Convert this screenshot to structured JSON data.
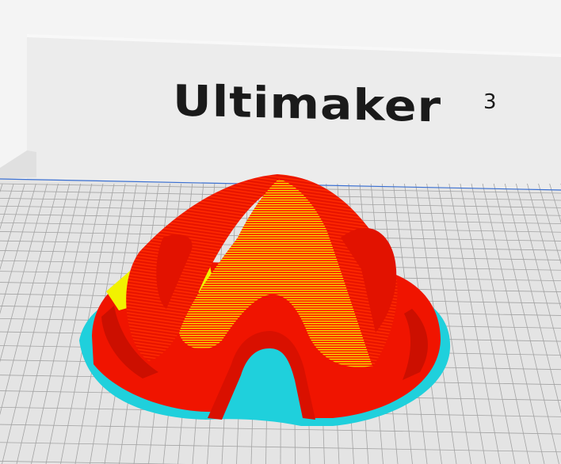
{
  "viewport": {
    "brand_name": "Ultimaker",
    "brand_model": "3"
  },
  "colors": {
    "background": "#f4f4f4",
    "back_panel": "#eeeeee",
    "build_plate": "#e3e3e3",
    "grid_line": "#9a9a9a",
    "wall_outer": "#ff1a00",
    "infill": "#ffff00",
    "skirt": "#22d3dd",
    "plate_edge": "#3a6fd1"
  },
  "icons": [
    "build-plate",
    "printer-back-panel",
    "sliced-model-layers"
  ]
}
